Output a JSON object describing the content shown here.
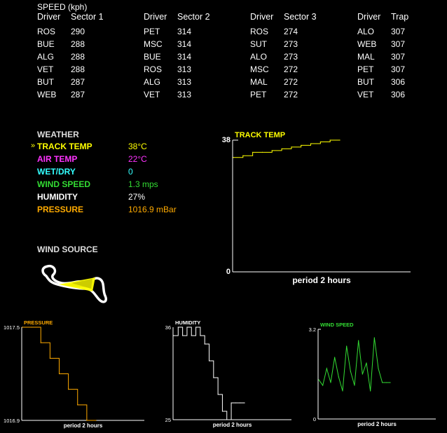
{
  "speed": {
    "title": "SPEED (kph)",
    "groups": [
      {
        "h1": "Driver",
        "h2": "Sector 1",
        "rows": [
          [
            "ROS",
            "290"
          ],
          [
            "BUE",
            "288"
          ],
          [
            "ALG",
            "288"
          ],
          [
            "VET",
            "288"
          ],
          [
            "BUT",
            "287"
          ],
          [
            "WEB",
            "287"
          ]
        ]
      },
      {
        "h1": "Driver",
        "h2": "Sector 2",
        "rows": [
          [
            "PET",
            "314"
          ],
          [
            "MSC",
            "314"
          ],
          [
            "BUE",
            "314"
          ],
          [
            "ROS",
            "313"
          ],
          [
            "ALG",
            "313"
          ],
          [
            "VET",
            "313"
          ]
        ]
      },
      {
        "h1": "Driver",
        "h2": "Sector 3",
        "rows": [
          [
            "ROS",
            "274"
          ],
          [
            "SUT",
            "273"
          ],
          [
            "ALO",
            "273"
          ],
          [
            "MSC",
            "272"
          ],
          [
            "MAL",
            "272"
          ],
          [
            "PET",
            "272"
          ]
        ]
      },
      {
        "h1": "Driver",
        "h2": "Trap",
        "rows": [
          [
            "ALO",
            "307"
          ],
          [
            "WEB",
            "307"
          ],
          [
            "MAL",
            "307"
          ],
          [
            "PET",
            "307"
          ],
          [
            "BUT",
            "306"
          ],
          [
            "VET",
            "306"
          ]
        ]
      }
    ]
  },
  "weather": {
    "title": "WEATHER",
    "selected_marker": "»",
    "items": [
      {
        "label": "TRACK TEMP",
        "value": "38°C",
        "color": "#ffff00"
      },
      {
        "label": "AIR TEMP",
        "value": "22°C",
        "color": "#ff33ff"
      },
      {
        "label": "WET/DRY",
        "value": "0",
        "color": "#33ffff"
      },
      {
        "label": "WIND SPEED",
        "value": "1.3 mps",
        "color": "#33dd33"
      },
      {
        "label": "HUMIDITY",
        "value": "27%",
        "color": "#ffffff"
      },
      {
        "label": "PRESSURE",
        "value": "1016.9 mBar",
        "color": "#ffaa00"
      }
    ]
  },
  "wind_source": {
    "title": "WIND SOURCE"
  },
  "charts": {
    "track_temp": {
      "title": "TRACK TEMP",
      "ymax": "38",
      "ymin": "0",
      "xlabel": "period 2 hours",
      "color": "#ffff00"
    },
    "pressure": {
      "title": "PRESSURE",
      "ymax": "1017.5",
      "ymin": "1016.9",
      "xlabel": "period 2 hours",
      "color": "#ffaa00"
    },
    "humidity": {
      "title": "HUMIDITY",
      "ymax": "36",
      "ymin": "25",
      "xlabel": "period 2 hours",
      "color": "#ffffff"
    },
    "wind_speed": {
      "title": "WIND SPEED",
      "ymax": "3.2",
      "ymin": "0",
      "xlabel": "period 2 hours",
      "color": "#33dd33"
    }
  },
  "chart_data": [
    {
      "type": "line",
      "title": "TRACK TEMP",
      "xlabel": "period 2 hours",
      "ylim": [
        0,
        38
      ],
      "series": [
        {
          "values": [
            33,
            33.5,
            34.5,
            34.5,
            35,
            35.5,
            36,
            36.5,
            37,
            37.5,
            38,
            38
          ]
        }
      ]
    },
    {
      "type": "line",
      "title": "PRESSURE",
      "xlabel": "period 2 hours",
      "ylim": [
        1016.9,
        1017.5
      ],
      "series": [
        {
          "values": [
            1017.5,
            1017.5,
            1017.4,
            1017.3,
            1017.2,
            1017.1,
            1017.0,
            1016.9,
            1016.9
          ]
        }
      ]
    },
    {
      "type": "line",
      "title": "HUMIDITY",
      "xlabel": "period 2 hours",
      "ylim": [
        25,
        36
      ],
      "series": [
        {
          "values": [
            35,
            36,
            35,
            36,
            35,
            36,
            35,
            34,
            32,
            30,
            28,
            26,
            25,
            27,
            27,
            27,
            27
          ]
        }
      ]
    },
    {
      "type": "line",
      "title": "WIND SPEED",
      "xlabel": "period 2 hours",
      "ylim": [
        0,
        3.2
      ],
      "series": [
        {
          "values": [
            1.4,
            1.2,
            1.8,
            1.3,
            2.2,
            1.5,
            1.0,
            2.6,
            1.7,
            1.2,
            2.8,
            1.6,
            2.0,
            1.0,
            2.9,
            1.8,
            1.3,
            1.3,
            1.3
          ]
        }
      ]
    }
  ]
}
